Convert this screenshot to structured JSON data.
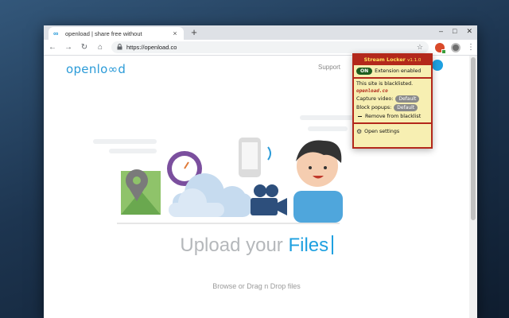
{
  "browser": {
    "tab_title": "openload | share free without",
    "tab_favicon": "∞",
    "tab_close": "×",
    "newtab": "+",
    "window_controls": [
      "–",
      "□",
      "✕"
    ],
    "url": "https://openload.co",
    "nav": {
      "back": "←",
      "forward": "→",
      "reload": "↻",
      "home": "⌂"
    },
    "lock": "🔒",
    "star": "☆",
    "menu": "⋮"
  },
  "site": {
    "logo": "openlo∞d",
    "support": "Support",
    "heading_prefix": "Upload your ",
    "heading_accent": "Files",
    "browse": "Browse or Drag n Drop files"
  },
  "popup": {
    "title": "Stream Locker",
    "version": "v1.1.0",
    "toggle": "ON",
    "extension_status": "Extension enabled",
    "blacklisted_text": "This site is blacklisted.",
    "domain": "openload.co",
    "capture_label": "Capture video:",
    "capture_value": "Default",
    "popups_label": "Block popups:",
    "popups_value": "Default",
    "remove_label": "Remove from blacklist",
    "settings_label": "Open settings",
    "settings_icon": "⚙"
  },
  "colors": {
    "accent": "#1ea0e0",
    "popup_border": "#b3281b",
    "popup_bg": "#f7efb2",
    "toggle_on": "#1f5e1f"
  }
}
